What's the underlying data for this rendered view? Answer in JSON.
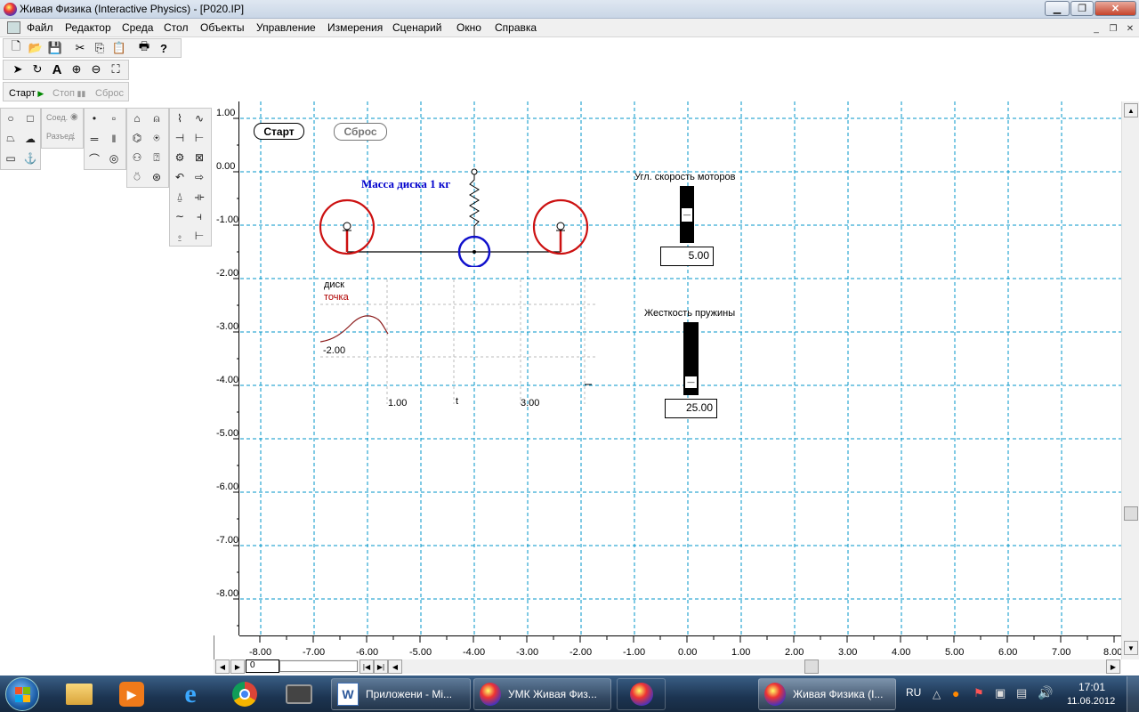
{
  "window": {
    "title": "Живая Физика (Interactive Physics) - [P020.IP]"
  },
  "menu": [
    "Файл",
    "Редактор",
    "Среда",
    "Стол",
    "Объекты",
    "Управление",
    "Измерения",
    "Сценарий",
    "Окно",
    "Справка"
  ],
  "runbar": {
    "start": "Старт",
    "stop": "Стоп",
    "reset": "Сброс"
  },
  "palette": {
    "join": "Соед.",
    "split": "Разъед."
  },
  "workspace": {
    "start_button": "Старт",
    "reset_button": "Сброс",
    "mass_label": "Масса диска 1 кг",
    "slider1": {
      "label": "Угл. скорость моторов",
      "value": "5.00",
      "level": 0.5
    },
    "slider2": {
      "label": "Жесткость пружины",
      "value": "25.00",
      "level": 0.1
    },
    "graph": {
      "legend1": "диск",
      "legend2": "точка",
      "y_label": "-2.00",
      "x_tick1": "1.00",
      "x_axis": "t",
      "x_tick2": "3.00"
    }
  },
  "rulers": {
    "y": [
      "1.00",
      "0.00",
      "-1.00",
      "-2.00",
      "-3.00",
      "-4.00",
      "-5.00",
      "-6.00",
      "-7.00",
      "-8.00"
    ],
    "x": [
      "-8.00",
      "-7.00",
      "-6.00",
      "-5.00",
      "-4.00",
      "-3.00",
      "-2.00",
      "-1.00",
      "0.00",
      "1.00",
      "2.00",
      "3.00",
      "4.00",
      "5.00",
      "6.00",
      "7.00",
      "8.00"
    ]
  },
  "frame_counter": "0",
  "taskbar": {
    "items": [
      "Приложени - Mi...",
      "УМК Живая Физ...",
      "Живая Физика (I..."
    ],
    "lang": "RU",
    "time": "17:01",
    "date": "11.06.2012"
  },
  "colors": {
    "grid": "#0096c8",
    "mass_label": "#0000cc",
    "red_wheel": "#cc1111",
    "blue_disk": "#1111cc"
  }
}
